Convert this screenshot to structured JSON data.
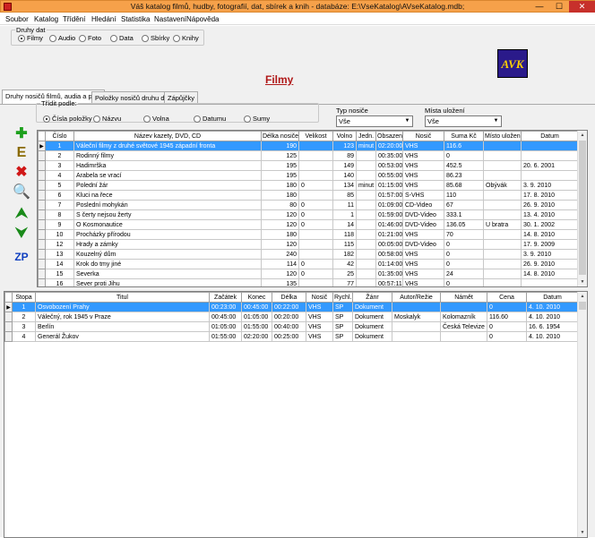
{
  "window": {
    "title": "Váš katalog filmů, hudby, fotografií, dat, sbírek a knih - databáze:     E:\\VseKatalog\\AVseKatalog.mdb;",
    "min": "—",
    "max": "☐",
    "close": "✕"
  },
  "menu": [
    "Soubor",
    "Katalog",
    "Třídění",
    "Hledání",
    "Statistika",
    "Nastavení",
    "Nápověda"
  ],
  "data_types": {
    "legend": "Druhy dat",
    "options": [
      "Filmy",
      "Audio",
      "Foto",
      "Data",
      "Sbírky",
      "Knihy"
    ],
    "selected": "Filmy"
  },
  "logo_text": "AVK",
  "heading": "Filmy",
  "tabs": [
    "Druhy nosičů filmů, audia a pod.",
    "Položky nosičů druhu dat",
    "Zápůjčky"
  ],
  "sort": {
    "legend": "Třídit podle:",
    "options": [
      "Čísla položky",
      "Názvu",
      "Volna",
      "Datumu",
      "Sumy"
    ],
    "selected": "Čísla položky"
  },
  "medium_type": {
    "label": "Typ nosiče",
    "value": "Vše"
  },
  "storage": {
    "label": "Místa uložení",
    "value": "Vše"
  },
  "side_buttons": [
    {
      "name": "add",
      "glyph": "✚",
      "color": "#1ca01c"
    },
    {
      "name": "edit",
      "glyph": "E",
      "color": "#8a6a00"
    },
    {
      "name": "delete",
      "glyph": "✖",
      "color": "#d01818"
    },
    {
      "name": "search",
      "glyph": "🔍",
      "color": "#1060c0"
    },
    {
      "name": "move-up",
      "glyph": "⮝",
      "color": "#1a8a1a"
    },
    {
      "name": "move-down",
      "glyph": "⮟",
      "color": "#1a8a1a"
    },
    {
      "name": "zp",
      "glyph": "ZP",
      "color": "#1040c0"
    }
  ],
  "top_table": {
    "columns": [
      "Číslo",
      "Název kazety, DVD, CD",
      "Délka nosiče",
      "Velikost",
      "Volno",
      "Jedn.",
      "Obsazen",
      "Nosič",
      "Suma Kč",
      "Místo uložení",
      "Datum"
    ],
    "rows": [
      [
        "1",
        "Váleční filmy z druhé světové 1945 západní fronta",
        "190",
        "",
        "123",
        "minut",
        "02:20:00",
        "VHS",
        "116.6",
        "",
        ""
      ],
      [
        "2",
        "Rodinný filmy",
        "125",
        "",
        "89",
        "",
        "00:35:00",
        "VHS",
        "0",
        "",
        ""
      ],
      [
        "3",
        "Hadimrška",
        "195",
        "",
        "149",
        "",
        "00:53:00",
        "VHS",
        "452.5",
        "",
        "20. 6. 2001"
      ],
      [
        "4",
        "Arabela se vrací",
        "195",
        "",
        "140",
        "",
        "00:55:00",
        "VHS",
        "86.23",
        "",
        ""
      ],
      [
        "5",
        "Polední žár",
        "180",
        "0",
        "134",
        "minut",
        "01:15:00",
        "VHS",
        "85.68",
        "Obývák",
        "3. 9. 2010"
      ],
      [
        "6",
        "Kluci na řece",
        "180",
        "",
        "85",
        "",
        "01:57:00",
        "S-VHS",
        "110",
        "",
        "17. 8. 2010"
      ],
      [
        "7",
        "Poslední mohykán",
        "80",
        "0",
        "11",
        "",
        "01:09:00",
        "CD-Video",
        "67",
        "",
        "26. 9. 2010"
      ],
      [
        "8",
        "S čerty nejsou žerty",
        "120",
        "0",
        "1",
        "",
        "01:59:00",
        "DVD-Video",
        "333.1",
        "",
        "13. 4. 2010"
      ],
      [
        "9",
        "O Kosmonautice",
        "120",
        "0",
        "14",
        "",
        "01:46:00",
        "DVD-Video",
        "136.05",
        "U bratra",
        "30. 1. 2002"
      ],
      [
        "10",
        "Procházky přírodou",
        "180",
        "",
        "118",
        "",
        "01:21:00",
        "VHS",
        "70",
        "",
        "14. 8. 2010"
      ],
      [
        "12",
        "Hrady a zámky",
        "120",
        "",
        "115",
        "",
        "00:05:00",
        "DVD-Video",
        "0",
        "",
        "17. 9. 2009"
      ],
      [
        "13",
        "Kouzelný dům",
        "240",
        "",
        "182",
        "",
        "00:58:00",
        "VHS",
        "0",
        "",
        "3. 9. 2010"
      ],
      [
        "14",
        "Krok do tmy jiné",
        "114",
        "0",
        "42",
        "",
        "01:14:00",
        "VHS",
        "0",
        "",
        "26. 9. 2010"
      ],
      [
        "15",
        "Severka",
        "120",
        "0",
        "25",
        "",
        "01:35:00",
        "VHS",
        "24",
        "",
        "14. 8. 2010"
      ],
      [
        "16",
        "Sever proti Jihu",
        "135",
        "",
        "77",
        "",
        "00:57:11",
        "VHS",
        "0",
        "",
        ""
      ]
    ]
  },
  "bottom_table": {
    "columns": [
      "Stopa",
      "Titul",
      "Začátek",
      "Konec",
      "Délka",
      "Nosič",
      "Rychl.",
      "Žánr",
      "Autor/Režie",
      "Námět",
      "Cena",
      "Datum"
    ],
    "rows": [
      [
        "1",
        "Osvobození Prahy",
        "00:23:00",
        "00:45:00",
        "00:22:00",
        "VHS",
        "SP",
        "Dokument",
        "",
        "",
        "0",
        "4. 10. 2010"
      ],
      [
        "2",
        "Válečný, rok 1945 v Praze",
        "00:45:00",
        "01:05:00",
        "00:20:00",
        "VHS",
        "SP",
        "Dokument",
        "Moskalyk",
        "Kolomazník",
        "116.60",
        "4. 10. 2010"
      ],
      [
        "3",
        "Berlín",
        "01:05:00",
        "01:55:00",
        "00:40:00",
        "VHS",
        "SP",
        "Dokument",
        "",
        "Česká Televize",
        "0",
        "16. 6. 1954"
      ],
      [
        "4",
        "Generál Žukov",
        "01:55:00",
        "02:20:00",
        "00:25:00",
        "VHS",
        "SP",
        "Dokument",
        "",
        "",
        "0",
        "4. 10. 2010"
      ]
    ]
  }
}
